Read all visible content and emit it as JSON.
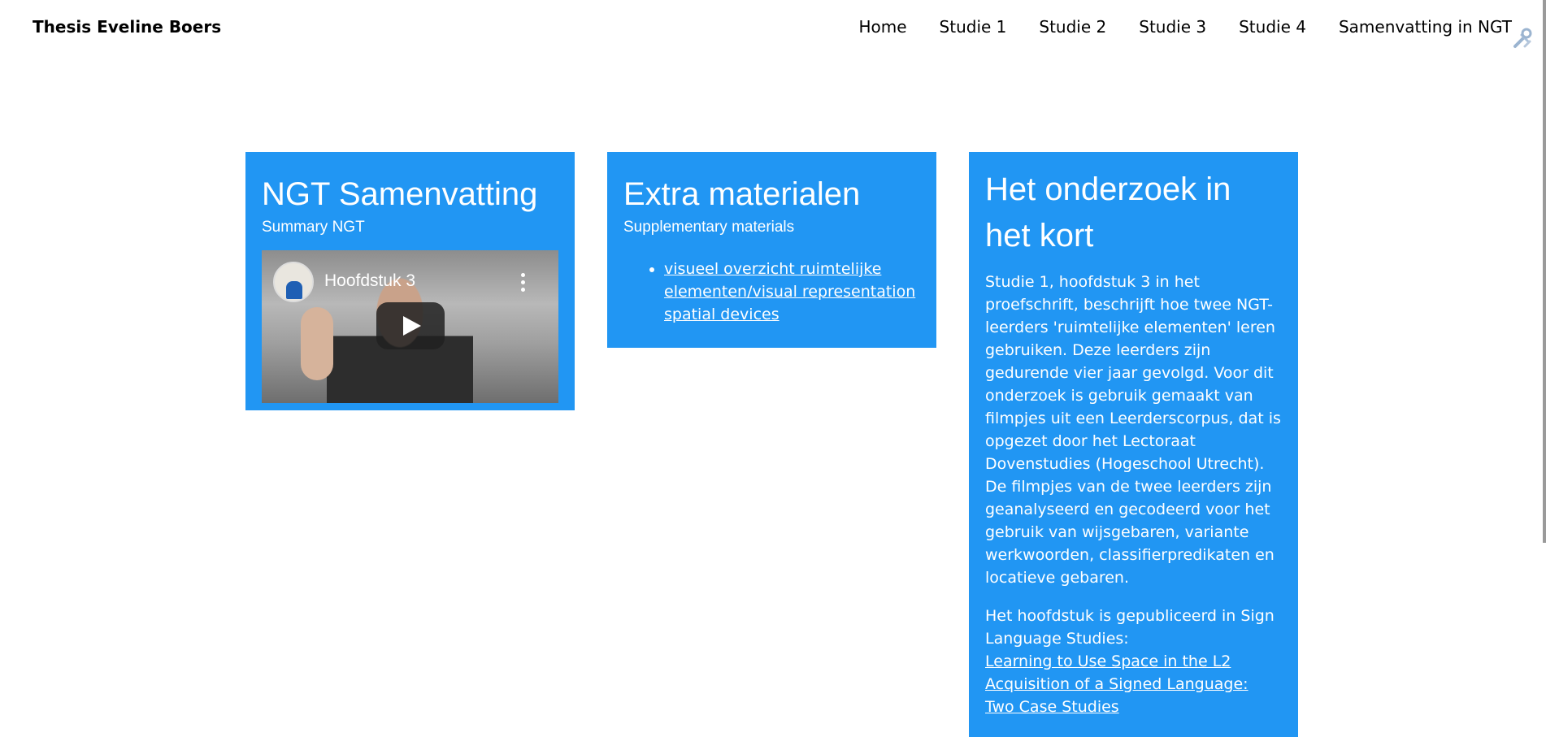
{
  "header": {
    "site_title": "Thesis Eveline Boers",
    "nav": [
      "Home",
      "Studie 1",
      "Studie 2",
      "Studie 3",
      "Studie 4",
      "Samenvatting in NGT"
    ]
  },
  "cards": {
    "ngt": {
      "title": "NGT Samenvatting",
      "subtitle": "Summary NGT",
      "video_title": "Hoofdstuk 3"
    },
    "extra": {
      "title": "Extra materialen",
      "subtitle": "Supplementary materials",
      "link": "visueel overzicht ruimtelijke elementen/visual representation spatial devices"
    },
    "onderzoek": {
      "title": "Het onderzoek in het kort",
      "paragraph1": "Studie 1, hoofdstuk 3 in het proefschrift, beschrijft hoe twee NGT-leerders 'ruimtelijke elementen' leren gebruiken. Deze leerders zijn gedurende vier jaar gevolgd. Voor dit onderzoek is gebruik gemaakt van filmpjes uit een Leerderscorpus, dat is opgezet door het Lectoraat Dovenstudies (Hogeschool Utrecht). De filmpjes van de twee leerders zijn geanalyseerd en gecodeerd voor het gebruik van wijsgebaren, variante werkwoorden, classifierpredikaten en locatieve gebaren.",
      "paragraph2_intro": "Het hoofdstuk is gepubliceerd in Sign Language Studies:",
      "paragraph2_link": "Learning to Use Space in the L2 Acquisition of a Signed Language: Two Case Studies"
    }
  },
  "colors": {
    "card_bg": "#2196f3",
    "text_on_card": "#ffffff"
  },
  "icons": {
    "tools": "tools-icon",
    "play": "play-icon",
    "more": "more-vert-icon"
  }
}
